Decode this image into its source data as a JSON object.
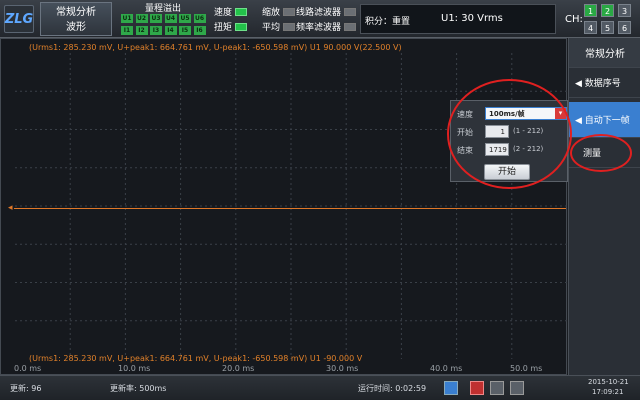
{
  "topbar": {
    "logo": "ZLG",
    "mode_line1": "常规分析",
    "mode_line2": "波形",
    "range_title": "量程溢出",
    "chips_row1": [
      "U1",
      "U2",
      "U3",
      "U4",
      "U5",
      "U6"
    ],
    "chips_row2": [
      "I1",
      "I2",
      "I3",
      "I4",
      "I5",
      "I6"
    ],
    "indicators": [
      {
        "label": "速度",
        "on": true
      },
      {
        "label": "扭矩",
        "on": true
      },
      {
        "label": "缩放",
        "on": false
      },
      {
        "label": "平均",
        "on": false
      },
      {
        "label": "线路滤波器",
        "on": false
      },
      {
        "label": "频率滤波器",
        "on": false
      }
    ],
    "accum_label": "积分：重置",
    "accum_value": "U1: 30 Vrms",
    "ch_label": "CH:",
    "ch_buttons": [
      "1",
      "2",
      "3",
      "4",
      "5",
      "6"
    ]
  },
  "plot": {
    "info_top": "(Urms1: 285.230 mV, U+peak1: 664.761 mV, U-peak1: -650.598 mV) U1   90.000 V(22.500 V)",
    "info_bottom": "(Urms1: 285.230 mV, U+peak1: 664.761 mV, U-peak1: -650.598 mV) U1   -90.000 V",
    "x_ticks": [
      "0.0 ms",
      "10.0 ms",
      "20.0 ms",
      "30.0 ms",
      "40.0 ms",
      "50.0 ms"
    ]
  },
  "side": {
    "title": "常规分析",
    "items": [
      "◀ 数据序号",
      "◀ 自动下一帧",
      "测量"
    ]
  },
  "popup": {
    "speed_label": "速度",
    "speed_value": "100ms/帧",
    "start_label": "开始",
    "start_value": "1",
    "start_range": "(1 - 212)",
    "end_label": "结束",
    "end_value": "1719",
    "end_range": "(2 - 212)",
    "button": "开始"
  },
  "status": {
    "refresh": "更新: 96",
    "rate": "更新率: 500ms",
    "runtime": "运行时间: 0:02:59",
    "date": "2015-10-21",
    "time": "17:09:21"
  }
}
